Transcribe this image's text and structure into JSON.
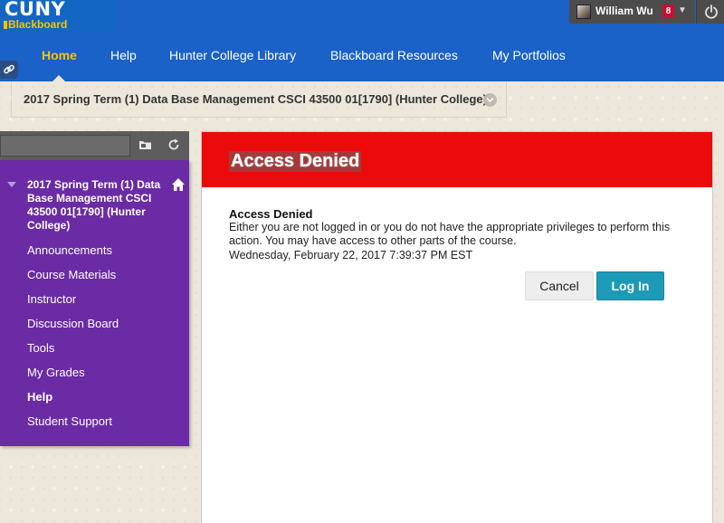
{
  "brand": {
    "line1": "CUNY",
    "line2": "Blackboard"
  },
  "user": {
    "name": "William Wu",
    "notifications": "8"
  },
  "nav": {
    "tabs": [
      {
        "label": "Home",
        "active": true
      },
      {
        "label": "Help"
      },
      {
        "label": "Hunter College Library"
      },
      {
        "label": "Blackboard Resources"
      },
      {
        "label": "My Portfolios"
      }
    ]
  },
  "breadcrumb": {
    "course": "2017 Spring Term (1) Data Base Management CSCI 43500 01[1790] (Hunter College)"
  },
  "course_menu": {
    "title": "2017 Spring Term (1) Data Base Management CSCI 43500 01[1790] (Hunter College)",
    "items": [
      {
        "label": "Announcements"
      },
      {
        "label": "Course Materials"
      },
      {
        "label": "Instructor"
      },
      {
        "label": "Discussion Board"
      },
      {
        "label": "Tools"
      },
      {
        "label": "My Grades"
      },
      {
        "label": "Help",
        "bold": true
      },
      {
        "label": "Student Support"
      }
    ]
  },
  "content": {
    "header_title": "Access Denied",
    "message_title": "Access Denied",
    "message_body": "Either you are not logged in or you do not have the appropriate privileges to perform this action. You may have access to other parts of the course.",
    "timestamp": "Wednesday, February 22, 2017 7:39:37 PM EST",
    "cancel_label": "Cancel",
    "login_label": "Log In"
  },
  "colors": {
    "topbar": "#1a61c8",
    "active_tab": "#f8c400",
    "course_menu": "#6a2ba5",
    "error_header": "#ec0b0b",
    "login_button": "#1c9ab8"
  },
  "icons": [
    "power-icon",
    "link-icon",
    "chevron-down-icon",
    "folder-icon",
    "refresh-icon",
    "home-icon",
    "caret-down-icon"
  ]
}
